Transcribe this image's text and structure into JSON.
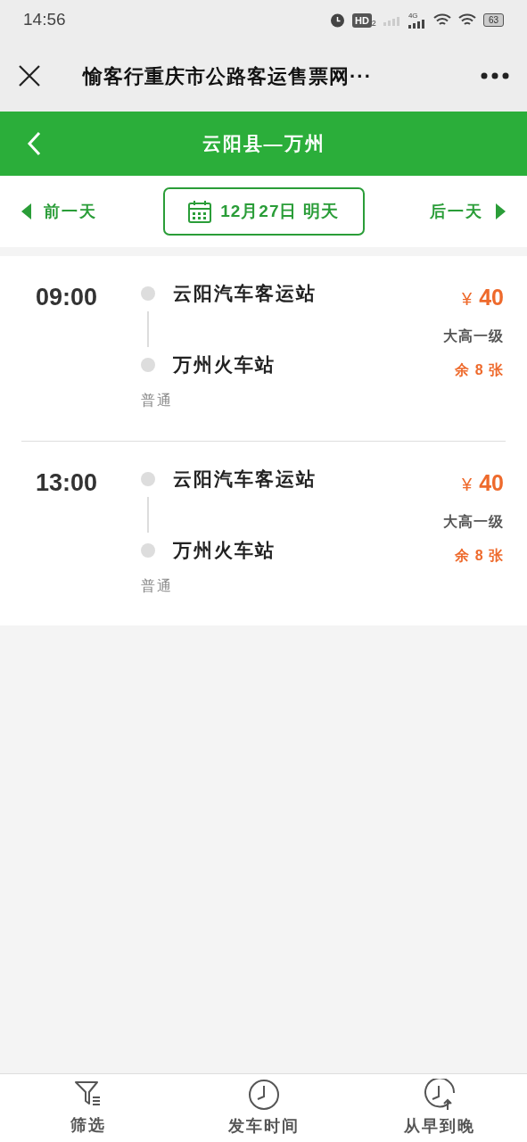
{
  "status_bar": {
    "time": "14:56",
    "hd_label": "HD",
    "hd_sub": "2",
    "network": "4G",
    "battery": "63"
  },
  "title_bar": {
    "title": "愉客行重庆市公路客运售票网···"
  },
  "header": {
    "title": "云阳县—万州"
  },
  "date_bar": {
    "prev": "前一天",
    "date": "12月27日 明天",
    "next": "后一天"
  },
  "trips": [
    {
      "time": "09:00",
      "from": "云阳汽车客运站",
      "to": "万州火车站",
      "type": "普通",
      "price_symbol": "¥",
      "price": "40",
      "grade": "大高一级",
      "remaining": "余 8 张"
    },
    {
      "time": "13:00",
      "from": "云阳汽车客运站",
      "to": "万州火车站",
      "type": "普通",
      "price_symbol": "¥",
      "price": "40",
      "grade": "大高一级",
      "remaining": "余 8 张"
    }
  ],
  "bottom_bar": [
    {
      "kind": "filter",
      "label": "筛选"
    },
    {
      "kind": "clock",
      "label": "发车时间"
    },
    {
      "kind": "clock-up",
      "label": "从早到晚"
    }
  ]
}
